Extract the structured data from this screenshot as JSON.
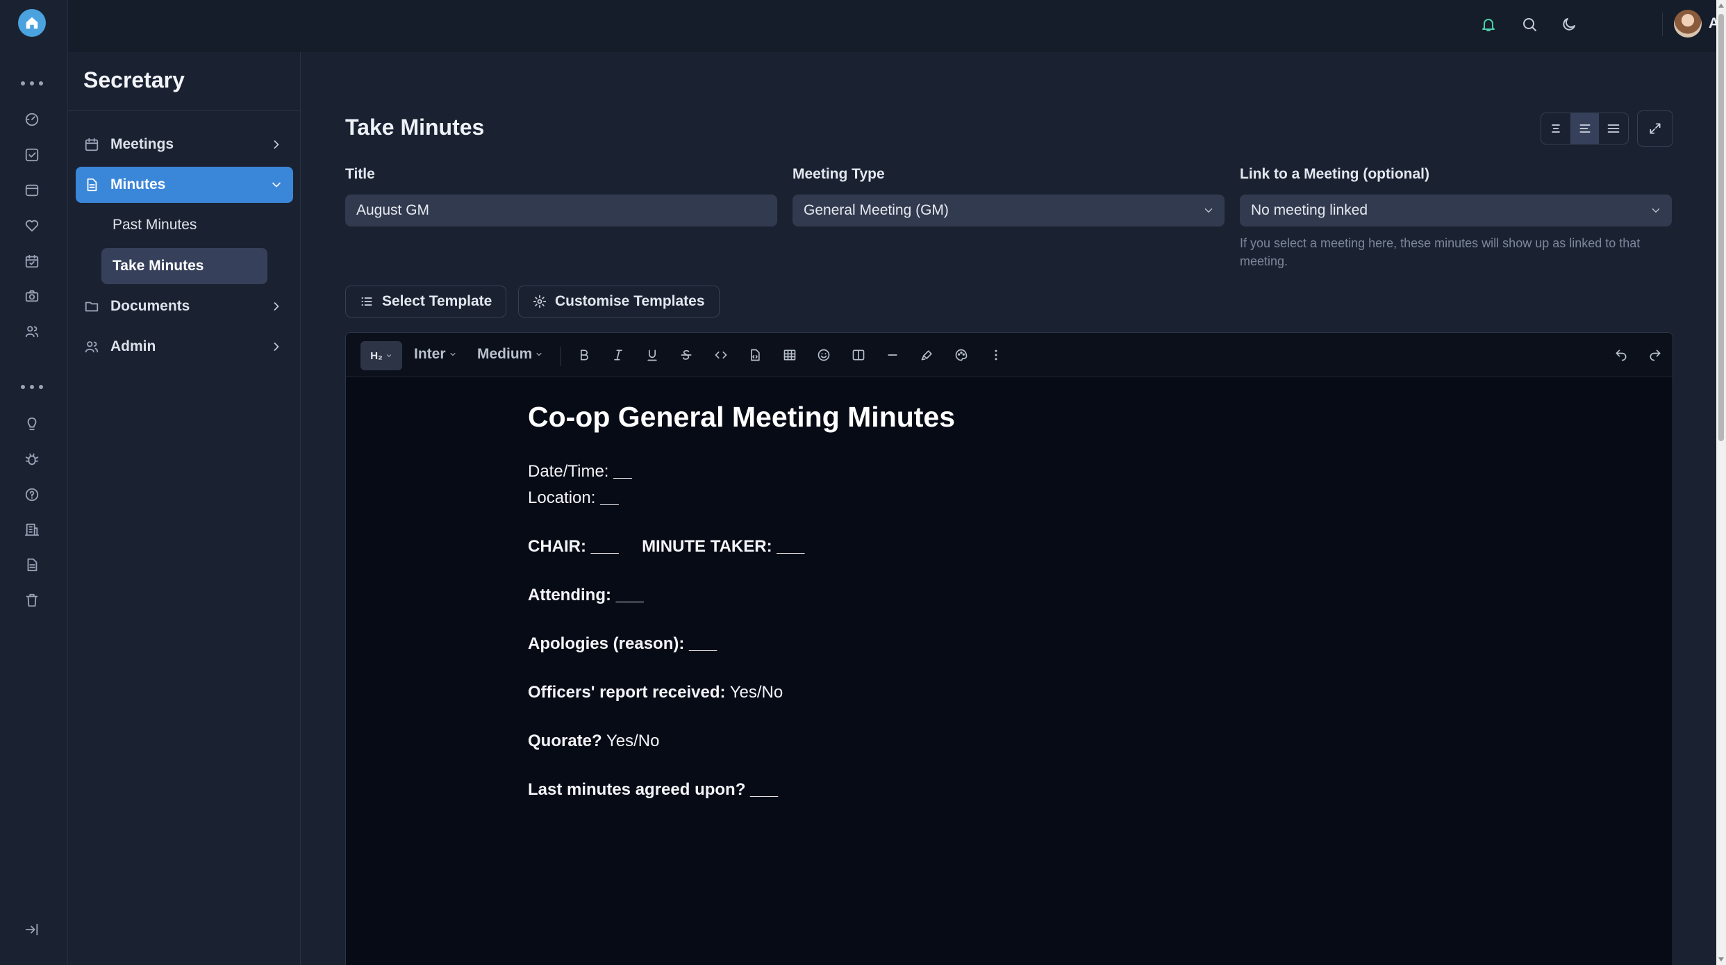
{
  "topbar": {
    "user_name": "Alex",
    "icons": [
      "bell-icon",
      "search-icon",
      "moon-icon",
      "avatar"
    ]
  },
  "rail": {
    "icons": [
      "home-icon",
      "more-dots-icon",
      "dashboard-icon",
      "checklist-icon",
      "inbox-icon",
      "heart-icon",
      "calendar-check-icon",
      "camera-icon",
      "users-icon",
      "more-dots-icon",
      "lightbulb-icon",
      "bug-icon",
      "help-icon",
      "building-icon",
      "document-icon",
      "trash-icon",
      "collapse-icon"
    ]
  },
  "subnav": {
    "title": "Secretary",
    "items": [
      {
        "label": "Meetings",
        "icon": "calendar-icon"
      },
      {
        "label": "Minutes",
        "icon": "file-icon"
      },
      {
        "label": "Documents",
        "icon": "folder-icon"
      },
      {
        "label": "Admin",
        "icon": "users-icon"
      }
    ],
    "minutes_children": [
      "Past Minutes",
      "Take Minutes"
    ]
  },
  "main": {
    "title": "Take Minutes",
    "fields": {
      "title": {
        "label": "Title",
        "value": "August GM"
      },
      "meeting_type": {
        "label": "Meeting Type",
        "value": "General Meeting (GM)"
      },
      "link": {
        "label": "Link to a Meeting (optional)",
        "value": "No meeting linked",
        "help": "If you select a meeting here, these minutes will show up as linked to that meeting."
      }
    },
    "buttons": {
      "select_template": "Select Template",
      "customise_templates": "Customise Templates"
    }
  },
  "editor": {
    "toolbar": {
      "heading": "H₂",
      "font": "Inter",
      "weight": "Medium"
    },
    "doc": {
      "heading": "Co-op General Meeting Minutes",
      "date_label": "Date/Time:",
      "date_blank": "__",
      "location_label": "Location:",
      "location_blank": "__",
      "chair_label": "CHAIR:",
      "chair_blank": "___",
      "minute_taker_label": "MINUTE TAKER:",
      "minute_taker_blank": "___",
      "attending_label": "Attending:",
      "attending_blank": "___",
      "apologies_label": "Apologies (reason):",
      "apologies_blank": "___",
      "officers_label": "Officers' report received:",
      "officers_value": "Yes/No",
      "quorate_label": "Quorate?",
      "quorate_value": "Yes/No",
      "last_minutes_label": "Last minutes agreed upon?",
      "last_minutes_blank": "___"
    }
  }
}
